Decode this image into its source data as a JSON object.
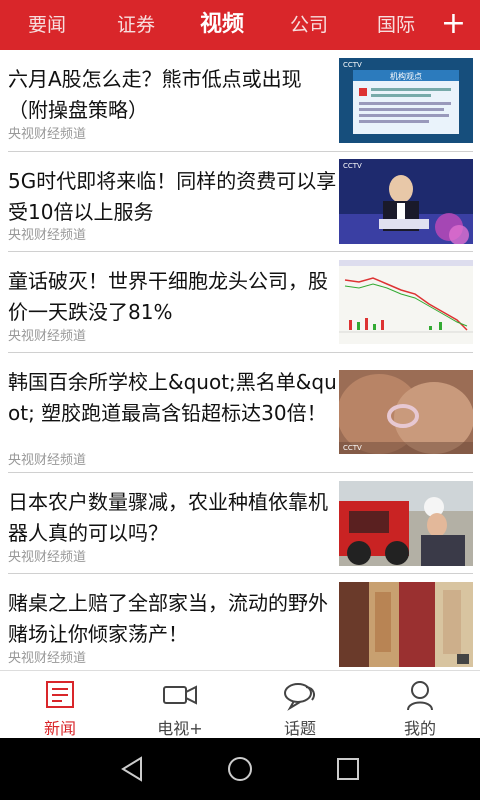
{
  "colors": {
    "brand_red": "#d9262a",
    "text": "#111111",
    "muted": "#999999"
  },
  "top_tabs": [
    {
      "label": "要闻"
    },
    {
      "label": "证券"
    },
    {
      "label": "视频"
    },
    {
      "label": "公司"
    },
    {
      "label": "国际"
    }
  ],
  "top_add_icon": "plus-icon",
  "articles": [
    {
      "title": "六月A股怎么走？熊市低点或出现（附操盘策略）",
      "source": "央视财经频道",
      "thumb_text": {
        "logo": "CCTV",
        "heading": "机构观点"
      }
    },
    {
      "title": "5G时代即将来临！同样的资费可以享受10倍以上服务",
      "source": "央视财经频道",
      "thumb_text": {
        "logo": "CCTV"
      }
    },
    {
      "title": "童话破灭！世界干细胞龙头公司，股价一天跌没了81%",
      "source": "央视财经频道",
      "thumb_text": {}
    },
    {
      "title": "韩国百余所学校上&quot;黑名单&quot; 塑胶跑道最高含铅超标达30倍！",
      "source": "央视财经频道",
      "thumb_text": {
        "logo": "CCTV"
      }
    },
    {
      "title": "日本农户数量骤减，农业种植依靠机器人真的可以吗？",
      "source": "央视财经频道",
      "thumb_text": {}
    },
    {
      "title": "赌桌之上赔了全部家当，流动的野外赌场让你倾家荡产！",
      "source": "央视财经频道",
      "thumb_text": {}
    }
  ],
  "bottom_nav": [
    {
      "label": "新闻",
      "icon": "newspaper-icon",
      "active": true
    },
    {
      "label": "电视+",
      "icon": "video-camera-icon",
      "active": false
    },
    {
      "label": "话题",
      "icon": "chat-bubbles-icon",
      "active": false
    },
    {
      "label": "我的",
      "icon": "user-icon",
      "active": false
    }
  ],
  "system_nav": [
    {
      "icon": "back-icon"
    },
    {
      "icon": "home-icon"
    },
    {
      "icon": "recents-icon"
    }
  ]
}
